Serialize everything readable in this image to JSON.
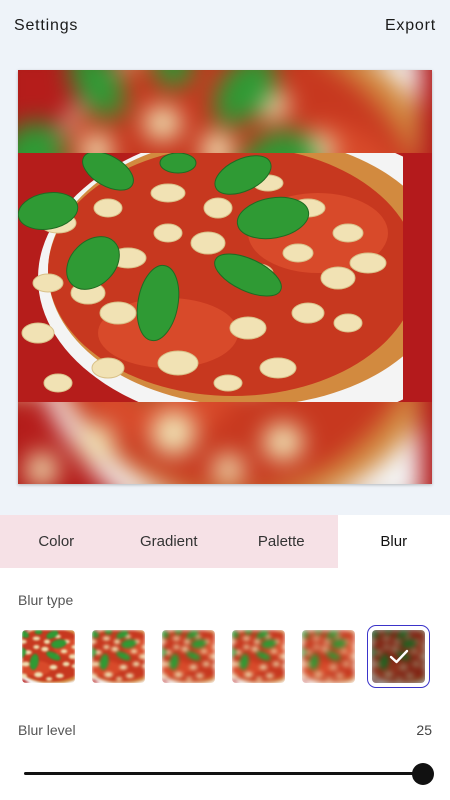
{
  "topbar": {
    "settings_label": "Settings",
    "export_label": "Export"
  },
  "tabs": [
    {
      "label": "Color",
      "active": false
    },
    {
      "label": "Gradient",
      "active": false
    },
    {
      "label": "Palette",
      "active": false
    },
    {
      "label": "Blur",
      "active": true
    }
  ],
  "blur_panel": {
    "blur_type_label": "Blur type",
    "blur_types": [
      {
        "icon": "blur-style-1",
        "selected": false
      },
      {
        "icon": "blur-style-2",
        "selected": false
      },
      {
        "icon": "blur-style-3",
        "selected": false
      },
      {
        "icon": "blur-style-4",
        "selected": false
      },
      {
        "icon": "blur-style-5",
        "selected": false
      },
      {
        "icon": "blur-style-6",
        "selected": true
      }
    ],
    "selected_icon": "check-icon",
    "blur_level_label": "Blur level",
    "blur_level_value": "25",
    "blur_level_fraction": 1.0
  },
  "colors": {
    "background": "#eef3f9",
    "tab_bar": "#f6e1e6",
    "selected_outline": "#3b34c9"
  }
}
